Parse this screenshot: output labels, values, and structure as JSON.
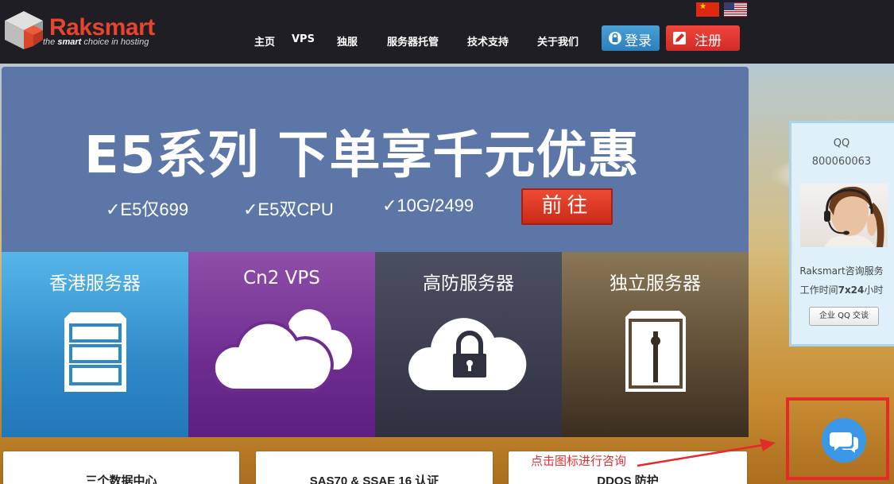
{
  "header": {
    "logo": {
      "name": "Raksmart",
      "tagline_prefix": "the ",
      "tagline_bold": "smart",
      "tagline_suffix": " choice in hosting"
    },
    "nav": [
      {
        "label": "主页"
      },
      {
        "label": "VPS"
      },
      {
        "label": "独服"
      },
      {
        "label": "服务器托管"
      },
      {
        "label": "技术支持"
      },
      {
        "label": "关于我们"
      }
    ],
    "login_label": "登录",
    "register_label": "注册",
    "flags": [
      "cn-flag-icon",
      "us-flag-icon"
    ]
  },
  "banner": {
    "title": "E5系列 下单享千元优惠",
    "features": [
      "✓E5仅699",
      "✓E5双CPU",
      "✓10G/2499"
    ],
    "cta_label": "前往"
  },
  "tiles": [
    {
      "label": "香港服务器",
      "icon": "server-icon",
      "color": "#3a9ad9"
    },
    {
      "label": "Cn2 VPS",
      "icon": "cloud-icon",
      "color": "#7a3a9a"
    },
    {
      "label": "高防服务器",
      "icon": "cloud-lock-icon",
      "color": "#3f4256"
    },
    {
      "label": "独立服务器",
      "icon": "server-tower-icon",
      "color": "#6f5a3d"
    }
  ],
  "cards": [
    {
      "title": "三个数据中心"
    },
    {
      "title": "SAS70 & SSAE 16 认证"
    },
    {
      "title": "DDOS 防护"
    }
  ],
  "qq_panel": {
    "title": "QQ",
    "number": "800060063",
    "service_text": "Raksmart咨询服务",
    "hours_prefix": "工作时间",
    "hours_bold": "7x24",
    "hours_suffix": "小时",
    "button_label": "企业 QQ 交谈"
  },
  "annotation": {
    "text": "点击图标进行咨询",
    "color": "#e52a2a"
  },
  "chat_button": {
    "icon": "chat-bubbles-icon",
    "color": "#3b97e8"
  }
}
